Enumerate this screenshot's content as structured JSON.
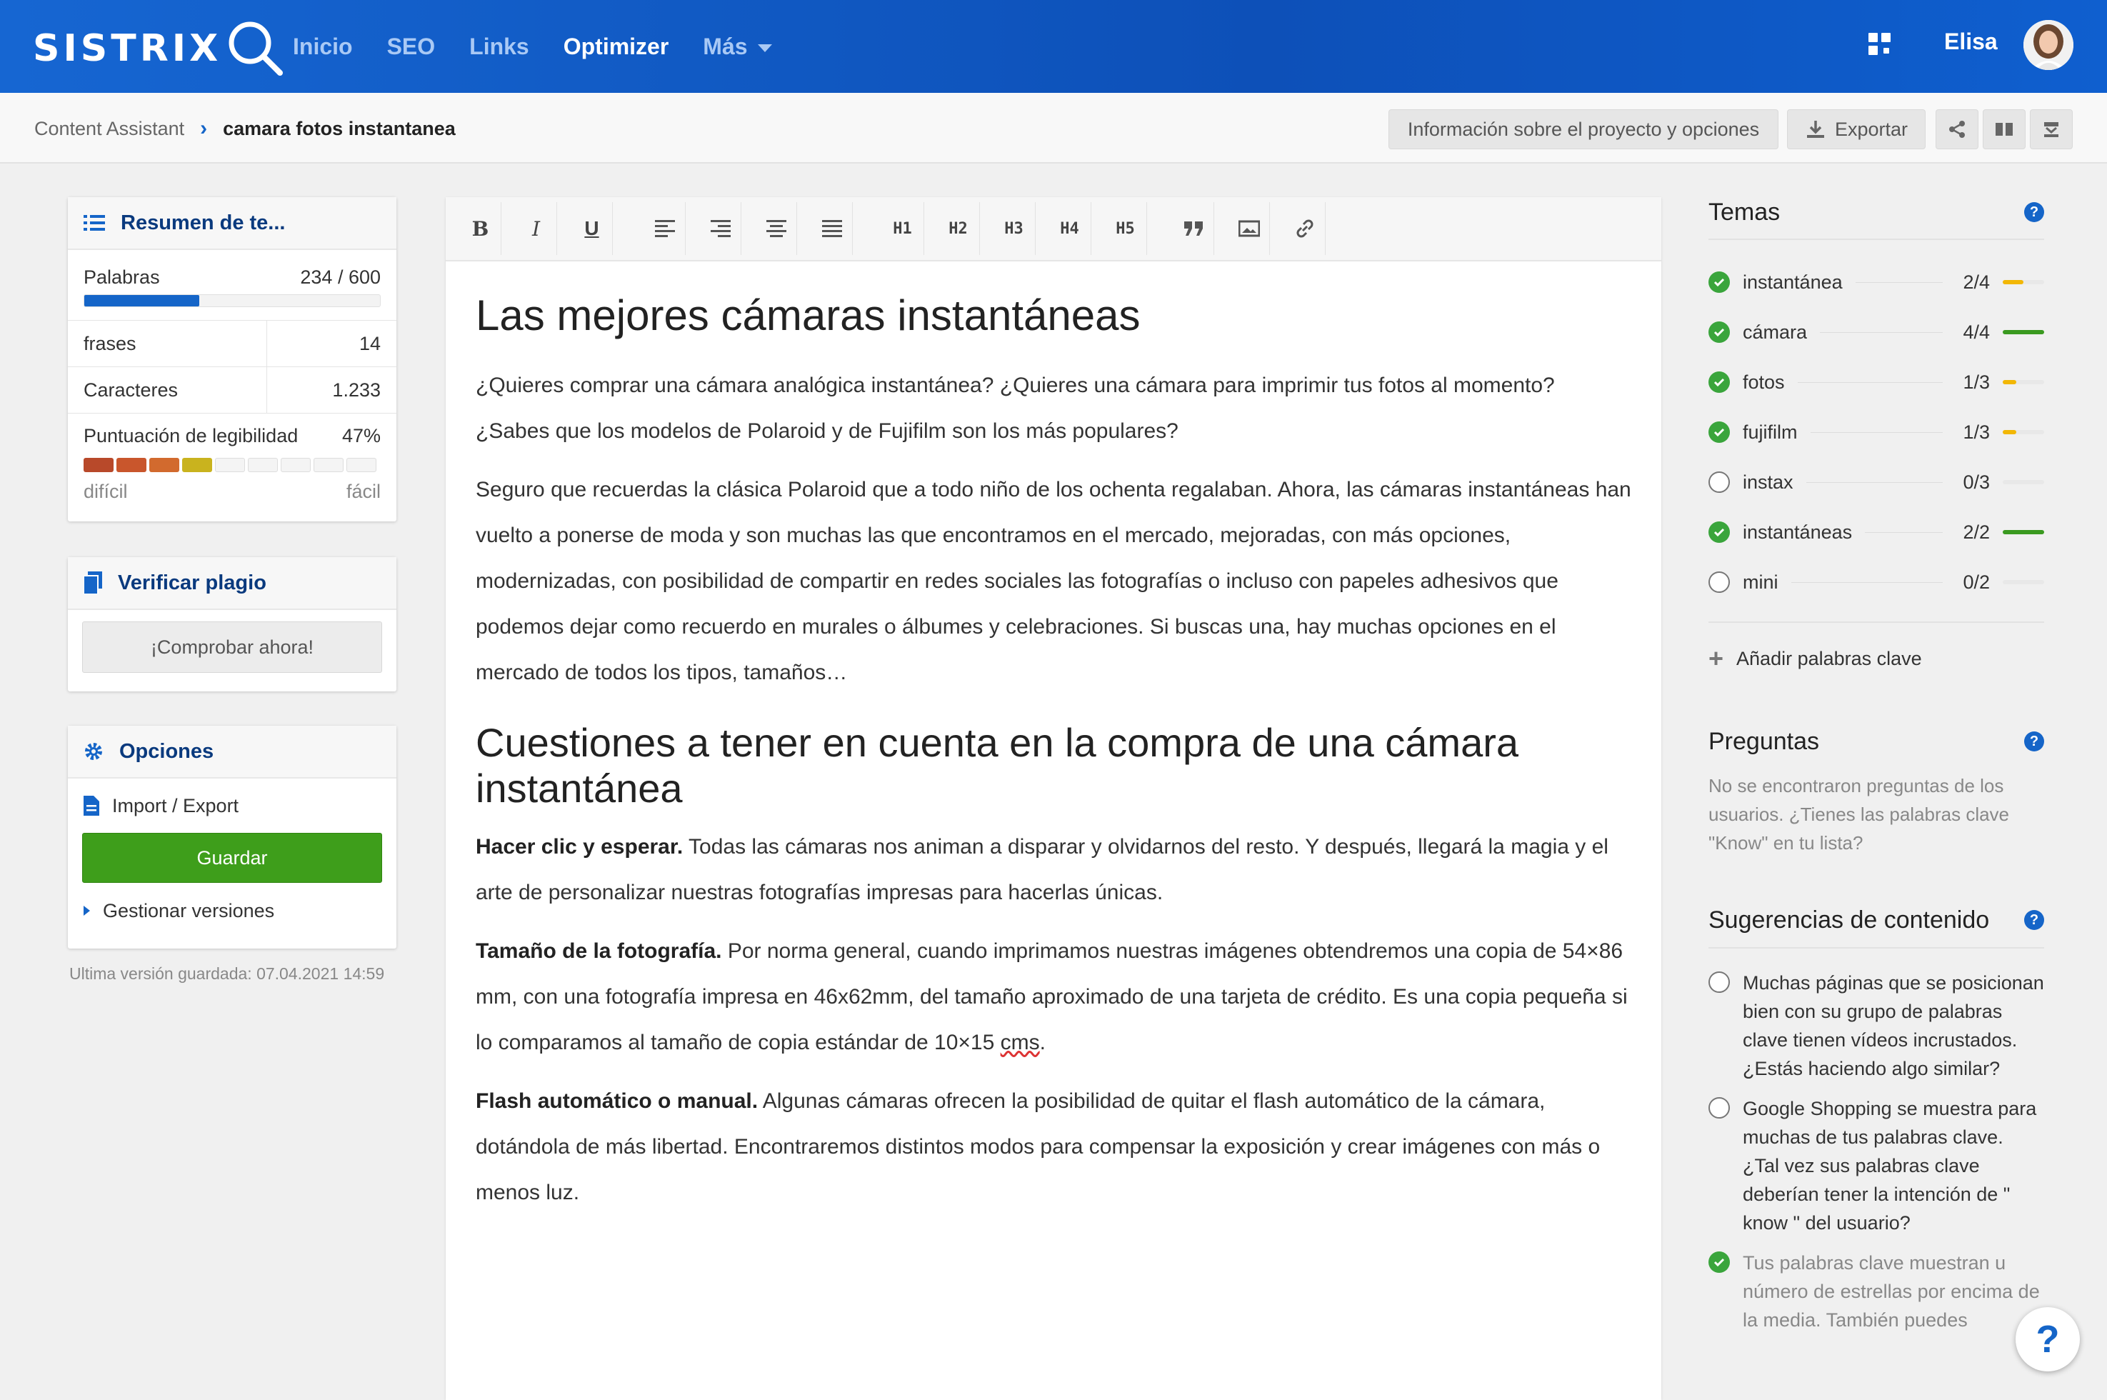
{
  "brand": {
    "name": "SISTRIX"
  },
  "nav": {
    "items": [
      "Inicio",
      "SEO",
      "Links",
      "Optimizer"
    ],
    "more": "Más"
  },
  "user": {
    "name": "Elisa"
  },
  "breadcrumb": {
    "parent": "Content Assistant",
    "current": "camara fotos instantanea"
  },
  "toolbar": {
    "info": "Información sobre el proyecto y opciones",
    "export": "Exportar"
  },
  "summary": {
    "title": "Resumen de te...",
    "words_label": "Palabras",
    "words_value": "234 / 600",
    "words_progress": 0.39,
    "rows": [
      {
        "label": "frases",
        "value": "14"
      },
      {
        "label": "Caracteres",
        "value": "1.233"
      }
    ],
    "readability_label": "Puntuación de legibilidad",
    "readability_value": "47%",
    "hard": "difícil",
    "easy": "fácil"
  },
  "plagiarism": {
    "title": "Verificar plagio",
    "button": "¡Comprobar ahora!"
  },
  "options": {
    "title": "Opciones",
    "import_export": "Import / Export",
    "save": "Guardar",
    "versions": "Gestionar versiones",
    "last_saved": "Ultima versión guardada: 07.04.2021 14:59"
  },
  "editor": {
    "tools": {
      "b": "B",
      "i": "I",
      "u": "U",
      "h1": "H1",
      "h2": "H2",
      "h3": "H3",
      "h4": "H4",
      "h5": "H5"
    },
    "h1": "Las mejores cámaras instantáneas",
    "p1": "¿Quieres comprar una cámara analógica instantánea? ¿Quieres una cámara para imprimir tus fotos al momento? ¿Sabes que los modelos de Polaroid y de Fujifilm son los más populares?",
    "p2": "Seguro que recuerdas la clásica Polaroid que a todo niño de los ochenta regalaban. Ahora, las cámaras instantáneas han vuelto a ponerse de moda y son muchas las que encontramos en el mercado, mejoradas, con más opciones, modernizadas, con posibilidad de compartir en redes sociales las fotografías o incluso con papeles adhesivos que podemos dejar como recuerdo en murales o álbumes y celebraciones. Si buscas una, hay muchas opciones en el mercado de todos los tipos, tamaños…",
    "h2": "Cuestiones a tener en cuenta en la compra de una cámara instantánea",
    "p3_bold": "Hacer clic y esperar.",
    "p3": " Todas las cámaras nos animan a disparar y olvidarnos del resto. Y después, llegará la magia y el arte de personalizar nuestras fotografías impresas para hacerlas únicas.",
    "p4_bold": "Tamaño de la fotografía.",
    "p4": " Por norma general, cuando imprimamos nuestras imágenes obtendremos una copia de 54×86 mm, con una fotografía impresa en 46x62mm, del tamaño aproximado de una tarjeta de crédito. Es una copia pequeña si lo comparamos al tamaño de copia estándar de 10×15 ",
    "p4_end": "cms",
    "p4_dot": ".",
    "p5_bold": "Flash automático o manual.",
    "p5": " Algunas cámaras ofrecen la posibilidad de quitar el flash automático de la cámara, dotándola de más libertad. Encontraremos distintos modos para compensar la exposición y crear imágenes con más o menos luz."
  },
  "topics": {
    "title": "Temas",
    "items": [
      {
        "name": "instantánea",
        "count": "2/4",
        "done": true,
        "fill": 0.5,
        "color": "#f2b705"
      },
      {
        "name": "cámara",
        "count": "4/4",
        "done": true,
        "fill": 1.0,
        "color": "#3a9a20"
      },
      {
        "name": "fotos",
        "count": "1/3",
        "done": true,
        "fill": 0.33,
        "color": "#f2b705"
      },
      {
        "name": "fujifilm",
        "count": "1/3",
        "done": true,
        "fill": 0.33,
        "color": "#f2b705"
      },
      {
        "name": "instax",
        "count": "0/3",
        "done": false,
        "fill": 0,
        "color": "#f2b705"
      },
      {
        "name": "instantáneas",
        "count": "2/2",
        "done": true,
        "fill": 1.0,
        "color": "#3a9a20"
      },
      {
        "name": "mini",
        "count": "0/2",
        "done": false,
        "fill": 0,
        "color": "#f2b705"
      }
    ],
    "add": "Añadir palabras clave"
  },
  "questions": {
    "title": "Preguntas",
    "text": "No se encontraron preguntas de los usuarios. ¿Tienes las palabras clave \"Know\" en tu lista?"
  },
  "suggestions": {
    "title": "Sugerencias de contenido",
    "items": [
      {
        "text": "Muchas páginas que se posicionan bien con su grupo de palabras clave tienen vídeos incrustados. ¿Estás haciendo algo similar?",
        "done": false
      },
      {
        "text": "Google Shopping se muestra para muchas de tus palabras clave. ¿Tal vez sus palabras clave deberían tener la intención de \" know \" del usuario?",
        "done": false
      },
      {
        "text": "Tus palabras clave muestran u número de estrellas por encima de la media. También puedes",
        "done": true
      }
    ]
  },
  "help_fab": "?"
}
